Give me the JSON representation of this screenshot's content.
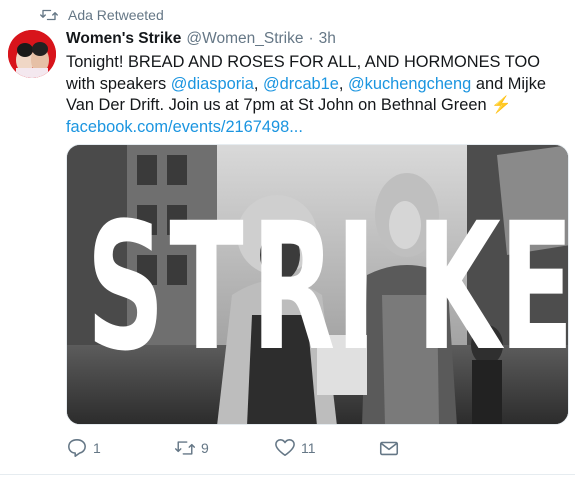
{
  "retweet": {
    "label": "Ada Retweeted",
    "icon": "retweet-icon"
  },
  "tweet": {
    "author_name": "Women's Strike",
    "author_handle": "@Women_Strike",
    "separator": "·",
    "time": "3h",
    "text": {
      "t1": "Tonight! BREAD AND ROSES FOR ALL, AND HORMONES TOO with speakers ",
      "m1": "@diasporia",
      "s1": ", ",
      "m2": "@drcab1e",
      "s2": ", ",
      "m3": "@kuchengcheng",
      "t2": " and Mijke Van Der Drift. Join us at 7pm at St John on Bethnal Green ",
      "emoji": "⚡",
      "link": "facebook.com/events/2167498..."
    },
    "media": {
      "overlay_letters": [
        "S",
        "T",
        "R",
        "I",
        "K",
        "E"
      ],
      "description_icon": "photo"
    }
  },
  "actions": {
    "reply": {
      "icon": "reply-icon",
      "count": "1"
    },
    "retweet": {
      "icon": "retweet-icon",
      "count": "9"
    },
    "like": {
      "icon": "heart-icon",
      "count": "11"
    },
    "dm": {
      "icon": "envelope-icon"
    }
  },
  "colors": {
    "link": "#1b95e0",
    "secondary_text": "#657786",
    "primary_text": "#14171a",
    "avatar_bg": "#d8141b"
  }
}
